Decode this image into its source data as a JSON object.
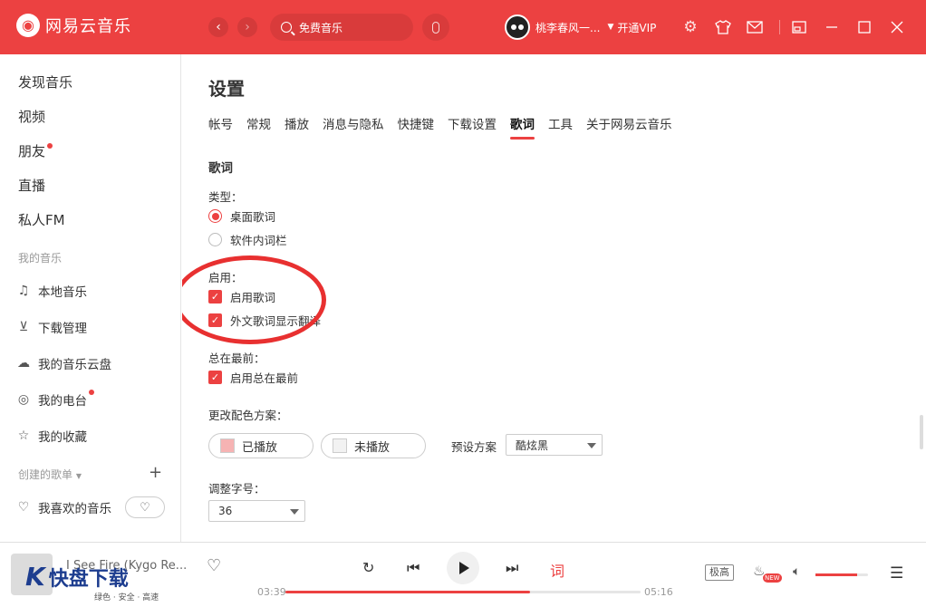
{
  "app": {
    "title": "网易云音乐"
  },
  "search": {
    "value": "免费音乐"
  },
  "user": {
    "name": "桃李春风一...",
    "vip": "开通VIP"
  },
  "sidebar": {
    "main": [
      "发现音乐",
      "视频",
      "朋友",
      "直播",
      "私人FM"
    ],
    "my_music_title": "我的音乐",
    "my_music": [
      "本地音乐",
      "下载管理",
      "我的音乐云盘",
      "我的电台",
      "我的收藏"
    ],
    "playlists_title": "创建的歌单",
    "liked": "我喜欢的音乐"
  },
  "settings": {
    "title": "设置",
    "tabs": [
      "帐号",
      "常规",
      "播放",
      "消息与隐私",
      "快捷键",
      "下载设置",
      "歌词",
      "工具",
      "关于网易云音乐"
    ],
    "active_tab": "歌词",
    "section": "歌词",
    "type_label": "类型：",
    "type_options": [
      "桌面歌词",
      "软件内词栏"
    ],
    "selected_type": "桌面歌词",
    "enable_label": "启用：",
    "enable_options": [
      "启用歌词",
      "外文歌词显示翻译"
    ],
    "ontop_label": "总在最前：",
    "ontop_option": "启用总在最前",
    "color_label": "更改配色方案：",
    "played": "已播放",
    "unplayed": "未播放",
    "preset_label": "预设方案",
    "preset_value": "酷炫黑",
    "font_label": "调整字号：",
    "font_size": "36"
  },
  "player": {
    "song": "I See Fire (Kygo Re...",
    "current": "03:39",
    "total": "05:16",
    "progress": 0.69,
    "quality": "极高",
    "volume": 0.8
  },
  "watermark": {
    "main": "快盘下载",
    "sub": "绿色 · 安全 · 高速"
  },
  "colors": {
    "accent": "#ec4141"
  }
}
